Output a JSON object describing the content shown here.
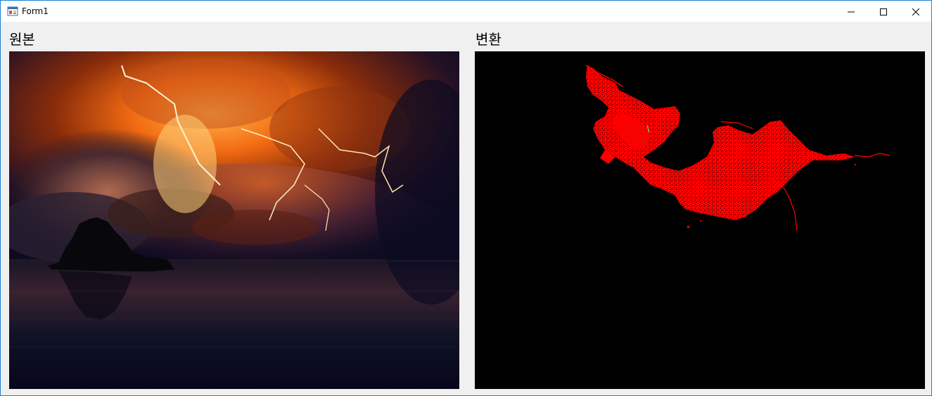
{
  "window": {
    "title": "Form1",
    "controls": {
      "minimize_icon": "minimize-icon",
      "maximize_icon": "maximize-icon",
      "close_icon": "close-icon"
    },
    "accent_color": "#1883d7"
  },
  "content": {
    "original_label": "원본",
    "transformed_label": "변환"
  },
  "images": {
    "original": "storm-lightning-over-sea-photo",
    "transformed": "red-edge-mask-on-black"
  },
  "colors": {
    "form_background": "#f0f0f0",
    "mask_color": "#ff0000",
    "mask_background": "#000000"
  }
}
